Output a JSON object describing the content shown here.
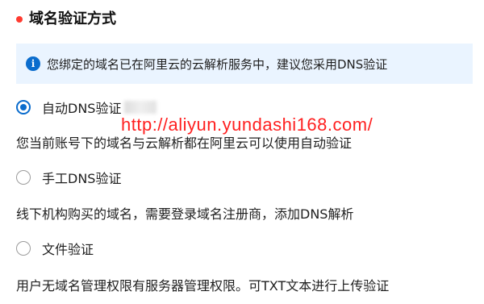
{
  "section": {
    "title": "域名验证方式",
    "dot_color": "#ff3b30"
  },
  "info": {
    "icon": "info-icon",
    "text": "您绑定的域名已在阿里云的云解析服务中，建议您采用DNS验证"
  },
  "options": [
    {
      "label": "自动DNS验证",
      "checked": true,
      "description": "您当前账号下的域名与云解析都在阿里云可以使用自动验证"
    },
    {
      "label": "手工DNS验证",
      "checked": false,
      "description": "线下机构购买的域名，需要登录域名注册商，添加DNS解析"
    },
    {
      "label": "文件验证",
      "checked": false,
      "description": "用户无域名管理权限有服务器管理权限。可TXT文本进行上传验证"
    }
  ],
  "watermark": "http://aliyun.yundashi168.com/",
  "colors": {
    "accent": "#0a6ccd",
    "banner_bg": "#eaf4ff",
    "watermark": "#ff2020"
  }
}
